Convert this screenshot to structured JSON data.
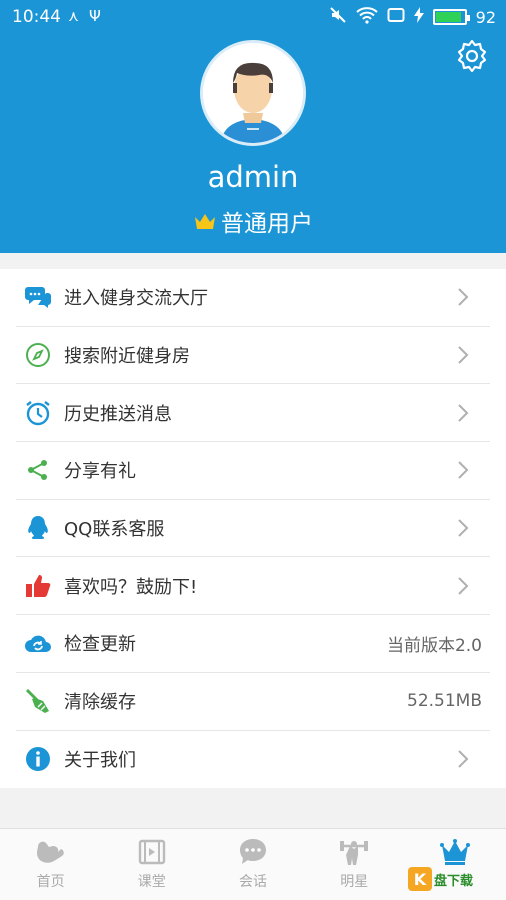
{
  "status_bar": {
    "time": "10:44",
    "battery_level": "92",
    "battery_fraction": 0.92
  },
  "profile": {
    "username": "admin",
    "level": "普通用户"
  },
  "menu": [
    {
      "label": "进入健身交流大厅",
      "icon": "chat-bubbles-icon",
      "value": ""
    },
    {
      "label": "搜索附近健身房",
      "icon": "compass-icon",
      "value": ""
    },
    {
      "label": "历史推送消息",
      "icon": "alarm-clock-icon",
      "value": ""
    },
    {
      "label": "分享有礼",
      "icon": "share-icon",
      "value": ""
    },
    {
      "label": "QQ联系客服",
      "icon": "qq-penguin-icon",
      "value": ""
    },
    {
      "label": "喜欢吗？鼓励下!",
      "icon": "thumbs-up-icon",
      "value": ""
    },
    {
      "label": "检查更新",
      "icon": "cloud-refresh-icon",
      "value": "当前版本2.0"
    },
    {
      "label": "清除缓存",
      "icon": "broom-icon",
      "value": "52.51MB"
    },
    {
      "label": "关于我们",
      "icon": "info-icon",
      "value": ""
    }
  ],
  "tabs": [
    {
      "label": "首页",
      "icon": "muscle-icon",
      "active": false
    },
    {
      "label": "课堂",
      "icon": "film-icon",
      "active": false
    },
    {
      "label": "会话",
      "icon": "chat-icon",
      "active": false
    },
    {
      "label": "明星",
      "icon": "weightlifter-icon",
      "active": false
    },
    {
      "label": "",
      "icon": "crown-icon",
      "active": true
    }
  ],
  "watermark": {
    "text": "盘下载",
    "letter": "K"
  },
  "colors": {
    "primary": "#1b95d6",
    "crown": "#f5c518",
    "battery": "#30d158"
  }
}
